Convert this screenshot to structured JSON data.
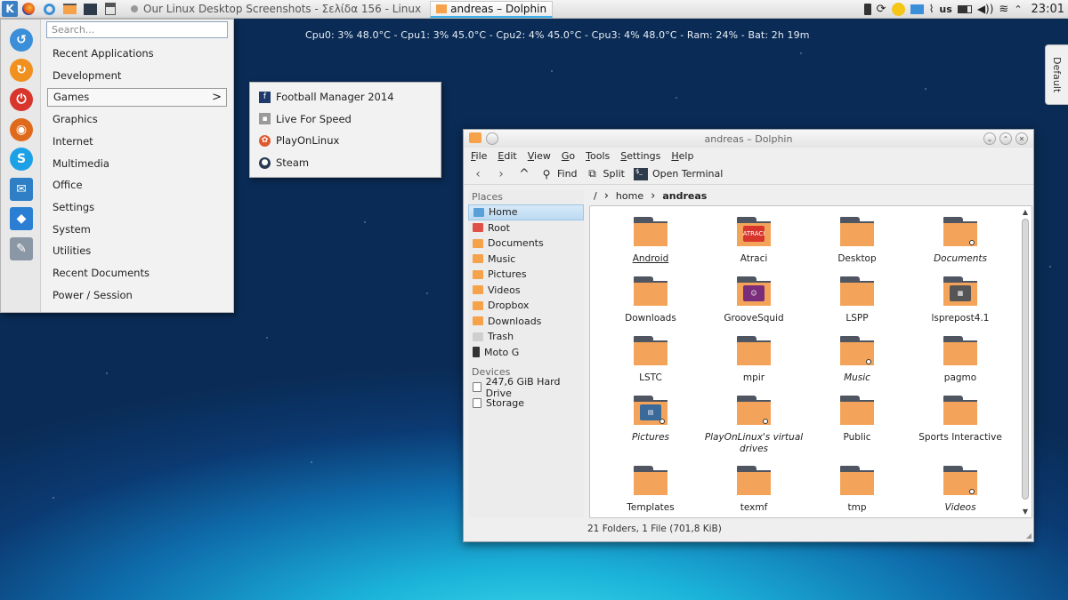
{
  "panel": {
    "k_label": "K",
    "tasks": [
      {
        "label": "Our Linux Desktop Screenshots - Σελίδα 156 - Linux",
        "active": false
      },
      {
        "label": "andreas – Dolphin",
        "active": true
      }
    ],
    "tray": {
      "keyboard_layout": "us",
      "clock": "23:01"
    }
  },
  "conky": {
    "text": "Cpu0: 3% 48.0°C - Cpu1: 3% 45.0°C - Cpu2: 4% 45.0°C - Cpu3: 4% 48.0°C - Ram: 24% - Bat:  2h 19m"
  },
  "sidetab": {
    "label": "Default"
  },
  "launcher": {
    "search_placeholder": "Search...",
    "favorites": [
      {
        "name": "system-settings",
        "color": "#3a8fd8",
        "glyph": "↺"
      },
      {
        "name": "update-manager",
        "color": "#f0901e",
        "glyph": "↻"
      },
      {
        "name": "power",
        "color": "#d8362c",
        "glyph": "⏻"
      },
      {
        "name": "firefox",
        "color": "#e06a1c",
        "glyph": "◉"
      },
      {
        "name": "skype",
        "color": "#1da1e6",
        "glyph": "S"
      },
      {
        "name": "mail",
        "color": "#2f7fc6",
        "glyph": "✉"
      },
      {
        "name": "dropbox",
        "color": "#2a7fd4",
        "glyph": "◆"
      },
      {
        "name": "tools",
        "color": "#8a97a5",
        "glyph": "✎"
      }
    ],
    "items": [
      {
        "label": "Recent Applications",
        "selected": false
      },
      {
        "label": "Development",
        "selected": false
      },
      {
        "label": "Games",
        "selected": true,
        "arrow": ">"
      },
      {
        "label": "Graphics",
        "selected": false
      },
      {
        "label": "Internet",
        "selected": false
      },
      {
        "label": "Multimedia",
        "selected": false
      },
      {
        "label": "Office",
        "selected": false
      },
      {
        "label": "Settings",
        "selected": false
      },
      {
        "label": "System",
        "selected": false
      },
      {
        "label": "Utilities",
        "selected": false
      },
      {
        "label": "Recent Documents",
        "selected": false
      },
      {
        "label": "Power / Session",
        "selected": false
      }
    ]
  },
  "games": [
    {
      "label": "Football Manager 2014",
      "icon_color": "#1e3a6a",
      "icon": "fm-icon",
      "glyph": "f"
    },
    {
      "label": "Live For Speed",
      "icon_color": "#9a9a9a",
      "icon": "lfs-icon",
      "glyph": "▪"
    },
    {
      "label": "PlayOnLinux",
      "icon_color": "#e05a30",
      "icon": "playonlinux-icon",
      "glyph": "✿"
    },
    {
      "label": "Steam",
      "icon_color": "#2a3a52",
      "icon": "steam-icon",
      "glyph": "●"
    }
  ],
  "dolphin": {
    "title": "andreas – Dolphin",
    "menus": [
      {
        "label": "File",
        "ul": "F",
        "rest": "ile"
      },
      {
        "label": "Edit",
        "ul": "E",
        "rest": "dit"
      },
      {
        "label": "View",
        "ul": "V",
        "rest": "iew"
      },
      {
        "label": "Go",
        "ul": "G",
        "rest": "o"
      },
      {
        "label": "Tools",
        "ul": "T",
        "rest": "ools"
      },
      {
        "label": "Settings",
        "ul": "S",
        "rest": "ettings"
      },
      {
        "label": "Help",
        "ul": "H",
        "rest": "elp"
      }
    ],
    "toolbar": {
      "back": "‹",
      "forward": "›",
      "up": "^",
      "find": "Find",
      "split": "Split",
      "open_terminal": "Open Terminal"
    },
    "places_header": "Places",
    "places": [
      {
        "label": "Home",
        "kind": "home",
        "selected": true
      },
      {
        "label": "Root",
        "kind": "red",
        "selected": false
      },
      {
        "label": "Documents",
        "kind": "folder",
        "selected": false
      },
      {
        "label": "Music",
        "kind": "folder",
        "selected": false
      },
      {
        "label": "Pictures",
        "kind": "folder",
        "selected": false
      },
      {
        "label": "Videos",
        "kind": "folder",
        "selected": false
      },
      {
        "label": "Dropbox",
        "kind": "folder",
        "selected": false
      },
      {
        "label": "Downloads",
        "kind": "folder",
        "selected": false
      },
      {
        "label": "Trash",
        "kind": "gray",
        "selected": false
      },
      {
        "label": "Moto G",
        "kind": "phone",
        "selected": false
      }
    ],
    "devices_header": "Devices",
    "devices": [
      {
        "label": "247,6 GiB Hard Drive"
      },
      {
        "label": "Storage"
      }
    ],
    "breadcrumb": {
      "root": "/",
      "parts": [
        "home",
        "andreas"
      ]
    },
    "files": [
      {
        "name": "Android",
        "style": "ul"
      },
      {
        "name": "Atraci",
        "style": "",
        "badge": "ATRACI",
        "badge_color": "#d8362c"
      },
      {
        "name": "Desktop",
        "style": ""
      },
      {
        "name": "Documents",
        "style": "it",
        "link": true
      },
      {
        "name": "Downloads",
        "style": ""
      },
      {
        "name": "GrooveSquid",
        "style": "",
        "badge": "☺",
        "badge_color": "#7a2d7a"
      },
      {
        "name": "LSPP",
        "style": ""
      },
      {
        "name": "lsprepost4.1",
        "style": "",
        "badge": "▦",
        "badge_color": "#555"
      },
      {
        "name": "LSTC",
        "style": ""
      },
      {
        "name": "mpir",
        "style": ""
      },
      {
        "name": "Music",
        "style": "it",
        "link": true
      },
      {
        "name": "pagmo",
        "style": ""
      },
      {
        "name": "Pictures",
        "style": "it",
        "badge": "▤",
        "badge_color": "#3a6a9a",
        "link": true
      },
      {
        "name": "PlayOnLinux's virtual drives",
        "style": "it",
        "link": true
      },
      {
        "name": "Public",
        "style": ""
      },
      {
        "name": "Sports Interactive",
        "style": ""
      },
      {
        "name": "Templates",
        "style": ""
      },
      {
        "name": "texmf",
        "style": ""
      },
      {
        "name": "tmp",
        "style": ""
      },
      {
        "name": "Videos",
        "style": "it",
        "link": true
      }
    ],
    "status": "21 Folders, 1 File (701,8 KiB)"
  }
}
